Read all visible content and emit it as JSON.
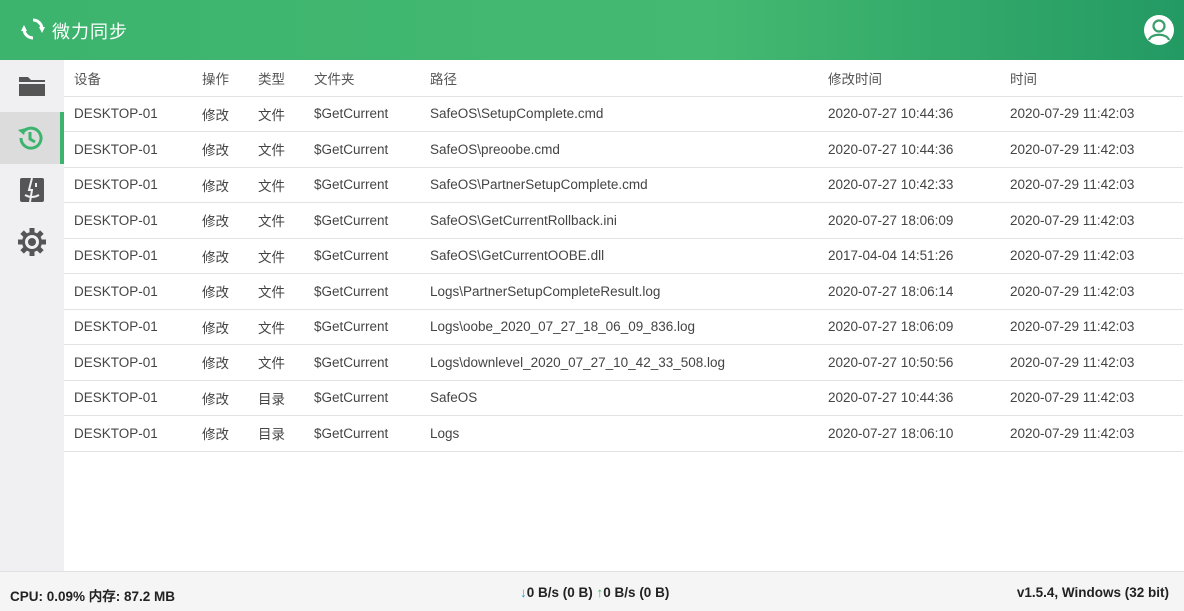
{
  "app": {
    "title": "微力同步"
  },
  "sidebar": {
    "items": [
      {
        "icon": "folder-icon",
        "name": "folders"
      },
      {
        "icon": "history-icon",
        "name": "history",
        "active": true
      },
      {
        "icon": "finder-icon",
        "name": "devices"
      },
      {
        "icon": "gear-icon",
        "name": "settings"
      }
    ]
  },
  "table": {
    "columns": [
      "设备",
      "操作",
      "类型",
      "文件夹",
      "路径",
      "修改时间",
      "时间"
    ],
    "rows": [
      [
        "DESKTOP-01",
        "修改",
        "文件",
        "$GetCurrent",
        "SafeOS\\SetupComplete.cmd",
        "2020-07-27 10:44:36",
        "2020-07-29 11:42:03"
      ],
      [
        "DESKTOP-01",
        "修改",
        "文件",
        "$GetCurrent",
        "SafeOS\\preoobe.cmd",
        "2020-07-27 10:44:36",
        "2020-07-29 11:42:03"
      ],
      [
        "DESKTOP-01",
        "修改",
        "文件",
        "$GetCurrent",
        "SafeOS\\PartnerSetupComplete.cmd",
        "2020-07-27 10:42:33",
        "2020-07-29 11:42:03"
      ],
      [
        "DESKTOP-01",
        "修改",
        "文件",
        "$GetCurrent",
        "SafeOS\\GetCurrentRollback.ini",
        "2020-07-27 18:06:09",
        "2020-07-29 11:42:03"
      ],
      [
        "DESKTOP-01",
        "修改",
        "文件",
        "$GetCurrent",
        "SafeOS\\GetCurrentOOBE.dll",
        "2017-04-04 14:51:26",
        "2020-07-29 11:42:03"
      ],
      [
        "DESKTOP-01",
        "修改",
        "文件",
        "$GetCurrent",
        "Logs\\PartnerSetupCompleteResult.log",
        "2020-07-27 18:06:14",
        "2020-07-29 11:42:03"
      ],
      [
        "DESKTOP-01",
        "修改",
        "文件",
        "$GetCurrent",
        "Logs\\oobe_2020_07_27_18_06_09_836.log",
        "2020-07-27 18:06:09",
        "2020-07-29 11:42:03"
      ],
      [
        "DESKTOP-01",
        "修改",
        "文件",
        "$GetCurrent",
        "Logs\\downlevel_2020_07_27_10_42_33_508.log",
        "2020-07-27 10:50:56",
        "2020-07-29 11:42:03"
      ],
      [
        "DESKTOP-01",
        "修改",
        "目录",
        "$GetCurrent",
        "SafeOS",
        "2020-07-27 10:44:36",
        "2020-07-29 11:42:03"
      ],
      [
        "DESKTOP-01",
        "修改",
        "目录",
        "$GetCurrent",
        "Logs",
        "2020-07-27 18:06:10",
        "2020-07-29 11:42:03"
      ]
    ]
  },
  "status": {
    "cpu": "CPU: 0.09% 内存: 87.2 MB",
    "down_arrow": "↓",
    "down": "0 B/s (0 B)",
    "up_arrow": "↑",
    "up": "0 B/s (0 B)",
    "version": "v1.5.4, Windows (32 bit)"
  },
  "colors": {
    "accent": "#3cb46e",
    "header_end": "#239a63",
    "sidebar_bg": "#f0f0f2"
  }
}
